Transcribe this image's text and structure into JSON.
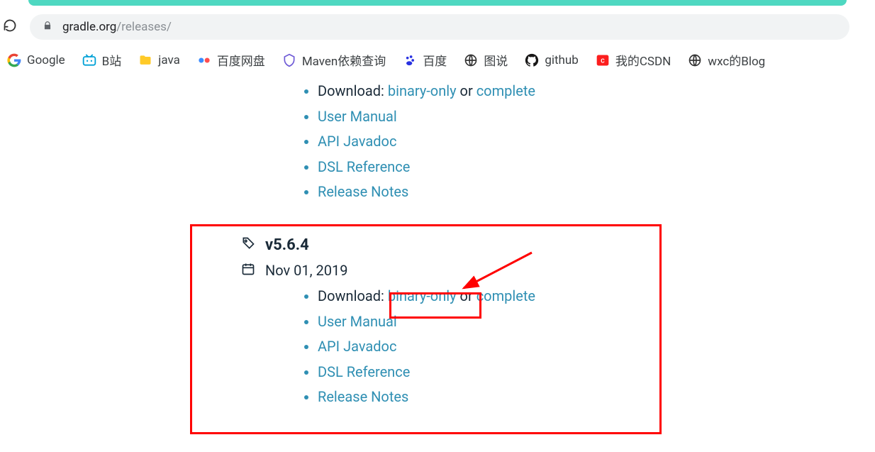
{
  "address": {
    "host": "gradle.org",
    "path": "/releases/"
  },
  "bookmarks": [
    {
      "name": "google",
      "label": "Google"
    },
    {
      "name": "bilibili",
      "label": "B站"
    },
    {
      "name": "java",
      "label": "java"
    },
    {
      "name": "baidu-pan",
      "label": "百度网盘"
    },
    {
      "name": "maven",
      "label": "Maven依赖查询"
    },
    {
      "name": "baidu",
      "label": "百度"
    },
    {
      "name": "tushuo",
      "label": "图说"
    },
    {
      "name": "github",
      "label": "github"
    },
    {
      "name": "csdn",
      "label": "我的CSDN"
    },
    {
      "name": "wxc-blog",
      "label": "wxc的Blog"
    }
  ],
  "release_prev": {
    "download_label": "Download: ",
    "binary": "binary-only",
    "or": " or ",
    "complete": "complete",
    "links": {
      "user_manual": "User Manual",
      "api_javadoc": "API Javadoc",
      "dsl_ref": "DSL Reference",
      "rel_notes": "Release Notes"
    }
  },
  "release": {
    "version": "v5.6.4",
    "date": "Nov 01, 2019",
    "download_label": "Download: ",
    "binary": "binary-only",
    "or": " or ",
    "complete": "complete",
    "links": {
      "user_manual": "User Manual",
      "api_javadoc": "API Javadoc",
      "dsl_ref": "DSL Reference",
      "rel_notes": "Release Notes"
    }
  }
}
